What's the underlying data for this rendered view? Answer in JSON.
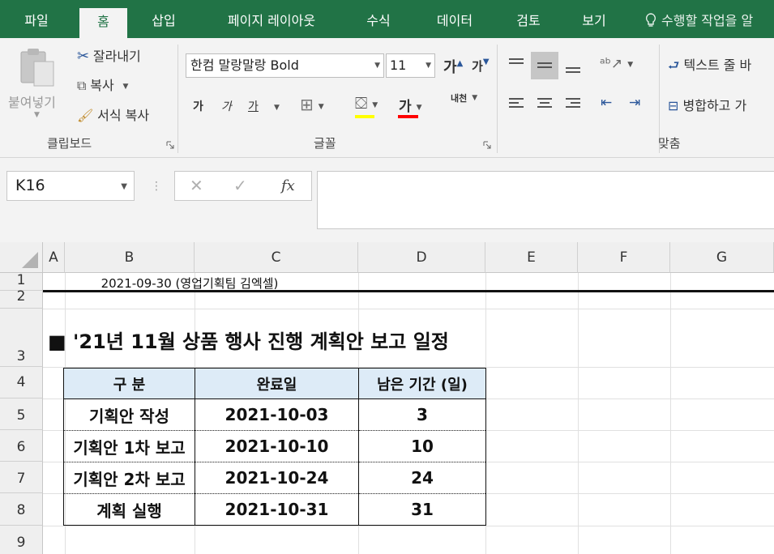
{
  "ribbon_tabs": [
    "파일",
    "홈",
    "삽입",
    "페이지 레이아웃",
    "수식",
    "데이터",
    "검토",
    "보기"
  ],
  "active_tab": "홈",
  "tell_me": "수행할 작업을 알",
  "clipboard": {
    "paste_label": "붙여넣기",
    "cut_label": "잘라내기",
    "copy_label": "복사",
    "format_painter_label": "서식 복사",
    "group_label": "클립보드"
  },
  "font": {
    "name": "한컴 말랑말랑 Bold",
    "size": "11",
    "bold": "가",
    "italic": "가",
    "underline": "가",
    "font_color_glyph": "가",
    "grow": "가",
    "shrink": "가",
    "phonetic": "내천",
    "group_label": "글꼴"
  },
  "alignment": {
    "wrap_text_label": "텍스트 줄 바",
    "merge_label": "병합하고 가",
    "group_label": "맞춤"
  },
  "formula_bar": {
    "name_box": "K16",
    "fx": "fx",
    "formula": ""
  },
  "sheet": {
    "columns": [
      "A",
      "B",
      "C",
      "D",
      "E",
      "F",
      "G"
    ],
    "rows": [
      "1",
      "2",
      "3",
      "4",
      "5",
      "6",
      "7",
      "8",
      "9"
    ],
    "note": "2021-09-30 (영업기획팀 김엑셀)",
    "title": "■ '21년 11월 상품 행사 진행 계획안 보고 일정",
    "table_headers": [
      "구 분",
      "완료일",
      "남은 기간 (일)"
    ],
    "table_rows": [
      [
        "기획안 작성",
        "2021-10-03",
        "3"
      ],
      [
        "기획안 1차 보고",
        "2021-10-10",
        "10"
      ],
      [
        "기획안 2차 보고",
        "2021-10-24",
        "24"
      ],
      [
        "계획 실행",
        "2021-10-31",
        "31"
      ]
    ]
  },
  "colors": {
    "excel_green": "#217346",
    "header_fill": "#ddebf7",
    "font_color_bar": "#ff0000"
  }
}
